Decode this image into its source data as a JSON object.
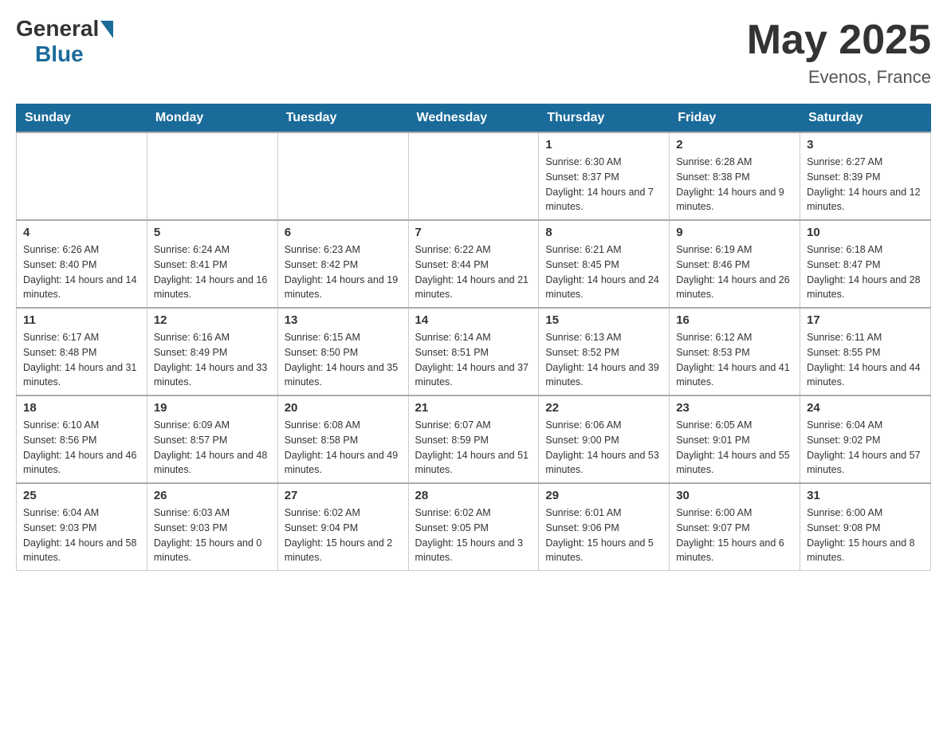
{
  "header": {
    "logo": {
      "general": "General",
      "blue": "Blue"
    },
    "title": "May 2025",
    "location": "Evenos, France"
  },
  "calendar": {
    "days_of_week": [
      "Sunday",
      "Monday",
      "Tuesday",
      "Wednesday",
      "Thursday",
      "Friday",
      "Saturday"
    ],
    "weeks": [
      [
        {
          "day": "",
          "info": ""
        },
        {
          "day": "",
          "info": ""
        },
        {
          "day": "",
          "info": ""
        },
        {
          "day": "",
          "info": ""
        },
        {
          "day": "1",
          "info": "Sunrise: 6:30 AM\nSunset: 8:37 PM\nDaylight: 14 hours and 7 minutes."
        },
        {
          "day": "2",
          "info": "Sunrise: 6:28 AM\nSunset: 8:38 PM\nDaylight: 14 hours and 9 minutes."
        },
        {
          "day": "3",
          "info": "Sunrise: 6:27 AM\nSunset: 8:39 PM\nDaylight: 14 hours and 12 minutes."
        }
      ],
      [
        {
          "day": "4",
          "info": "Sunrise: 6:26 AM\nSunset: 8:40 PM\nDaylight: 14 hours and 14 minutes."
        },
        {
          "day": "5",
          "info": "Sunrise: 6:24 AM\nSunset: 8:41 PM\nDaylight: 14 hours and 16 minutes."
        },
        {
          "day": "6",
          "info": "Sunrise: 6:23 AM\nSunset: 8:42 PM\nDaylight: 14 hours and 19 minutes."
        },
        {
          "day": "7",
          "info": "Sunrise: 6:22 AM\nSunset: 8:44 PM\nDaylight: 14 hours and 21 minutes."
        },
        {
          "day": "8",
          "info": "Sunrise: 6:21 AM\nSunset: 8:45 PM\nDaylight: 14 hours and 24 minutes."
        },
        {
          "day": "9",
          "info": "Sunrise: 6:19 AM\nSunset: 8:46 PM\nDaylight: 14 hours and 26 minutes."
        },
        {
          "day": "10",
          "info": "Sunrise: 6:18 AM\nSunset: 8:47 PM\nDaylight: 14 hours and 28 minutes."
        }
      ],
      [
        {
          "day": "11",
          "info": "Sunrise: 6:17 AM\nSunset: 8:48 PM\nDaylight: 14 hours and 31 minutes."
        },
        {
          "day": "12",
          "info": "Sunrise: 6:16 AM\nSunset: 8:49 PM\nDaylight: 14 hours and 33 minutes."
        },
        {
          "day": "13",
          "info": "Sunrise: 6:15 AM\nSunset: 8:50 PM\nDaylight: 14 hours and 35 minutes."
        },
        {
          "day": "14",
          "info": "Sunrise: 6:14 AM\nSunset: 8:51 PM\nDaylight: 14 hours and 37 minutes."
        },
        {
          "day": "15",
          "info": "Sunrise: 6:13 AM\nSunset: 8:52 PM\nDaylight: 14 hours and 39 minutes."
        },
        {
          "day": "16",
          "info": "Sunrise: 6:12 AM\nSunset: 8:53 PM\nDaylight: 14 hours and 41 minutes."
        },
        {
          "day": "17",
          "info": "Sunrise: 6:11 AM\nSunset: 8:55 PM\nDaylight: 14 hours and 44 minutes."
        }
      ],
      [
        {
          "day": "18",
          "info": "Sunrise: 6:10 AM\nSunset: 8:56 PM\nDaylight: 14 hours and 46 minutes."
        },
        {
          "day": "19",
          "info": "Sunrise: 6:09 AM\nSunset: 8:57 PM\nDaylight: 14 hours and 48 minutes."
        },
        {
          "day": "20",
          "info": "Sunrise: 6:08 AM\nSunset: 8:58 PM\nDaylight: 14 hours and 49 minutes."
        },
        {
          "day": "21",
          "info": "Sunrise: 6:07 AM\nSunset: 8:59 PM\nDaylight: 14 hours and 51 minutes."
        },
        {
          "day": "22",
          "info": "Sunrise: 6:06 AM\nSunset: 9:00 PM\nDaylight: 14 hours and 53 minutes."
        },
        {
          "day": "23",
          "info": "Sunrise: 6:05 AM\nSunset: 9:01 PM\nDaylight: 14 hours and 55 minutes."
        },
        {
          "day": "24",
          "info": "Sunrise: 6:04 AM\nSunset: 9:02 PM\nDaylight: 14 hours and 57 minutes."
        }
      ],
      [
        {
          "day": "25",
          "info": "Sunrise: 6:04 AM\nSunset: 9:03 PM\nDaylight: 14 hours and 58 minutes."
        },
        {
          "day": "26",
          "info": "Sunrise: 6:03 AM\nSunset: 9:03 PM\nDaylight: 15 hours and 0 minutes."
        },
        {
          "day": "27",
          "info": "Sunrise: 6:02 AM\nSunset: 9:04 PM\nDaylight: 15 hours and 2 minutes."
        },
        {
          "day": "28",
          "info": "Sunrise: 6:02 AM\nSunset: 9:05 PM\nDaylight: 15 hours and 3 minutes."
        },
        {
          "day": "29",
          "info": "Sunrise: 6:01 AM\nSunset: 9:06 PM\nDaylight: 15 hours and 5 minutes."
        },
        {
          "day": "30",
          "info": "Sunrise: 6:00 AM\nSunset: 9:07 PM\nDaylight: 15 hours and 6 minutes."
        },
        {
          "day": "31",
          "info": "Sunrise: 6:00 AM\nSunset: 9:08 PM\nDaylight: 15 hours and 8 minutes."
        }
      ]
    ]
  }
}
